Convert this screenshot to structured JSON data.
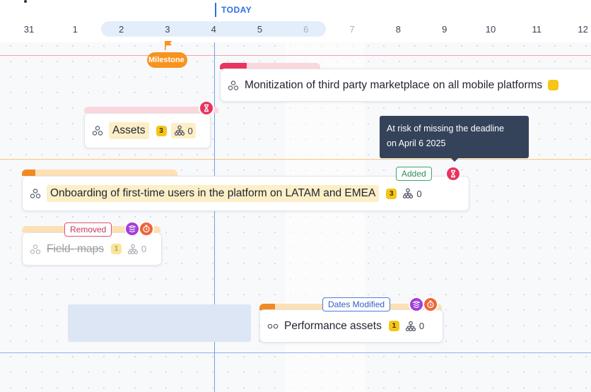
{
  "timeline": {
    "today_label": "TODAY",
    "dates": [
      {
        "label": "31",
        "muted": false
      },
      {
        "label": "1",
        "muted": false
      },
      {
        "label": "2",
        "muted": false
      },
      {
        "label": "3",
        "muted": false
      },
      {
        "label": "4",
        "muted": false
      },
      {
        "label": "5",
        "muted": false
      },
      {
        "label": "6",
        "muted": true
      },
      {
        "label": "7",
        "muted": true
      },
      {
        "label": "8",
        "muted": false
      },
      {
        "label": "9",
        "muted": false
      },
      {
        "label": "10",
        "muted": false
      },
      {
        "label": "11",
        "muted": false
      },
      {
        "label": "12",
        "muted": false
      }
    ]
  },
  "milestone": {
    "label": "Milestone",
    "icon": "flag-icon"
  },
  "cards": {
    "monitization": {
      "title": "Monitization of third party marketplace on all mobile platforms"
    },
    "assets": {
      "title": "Assets",
      "count": "3",
      "deps": "0"
    },
    "onboarding": {
      "title": "Onboarding of first-time users in the platform on LATAM and EMEA",
      "count": "3",
      "deps": "0",
      "badge": "Added"
    },
    "field_maps": {
      "title": "Field- maps",
      "count": "1",
      "deps": "0",
      "badge": "Removed"
    },
    "performance": {
      "title": "Performance assets",
      "count": "1",
      "deps": "0",
      "badge": "Dates Modified"
    }
  },
  "tooltip": {
    "line1": "At risk of missing the deadline",
    "line2": "on April 6 2025"
  },
  "colors": {
    "today": "#2f6fe0",
    "milestone": "#f7931e",
    "risk": "#e8345f",
    "count_badge": "#f5c518",
    "tooltip_bg": "#34435a"
  }
}
